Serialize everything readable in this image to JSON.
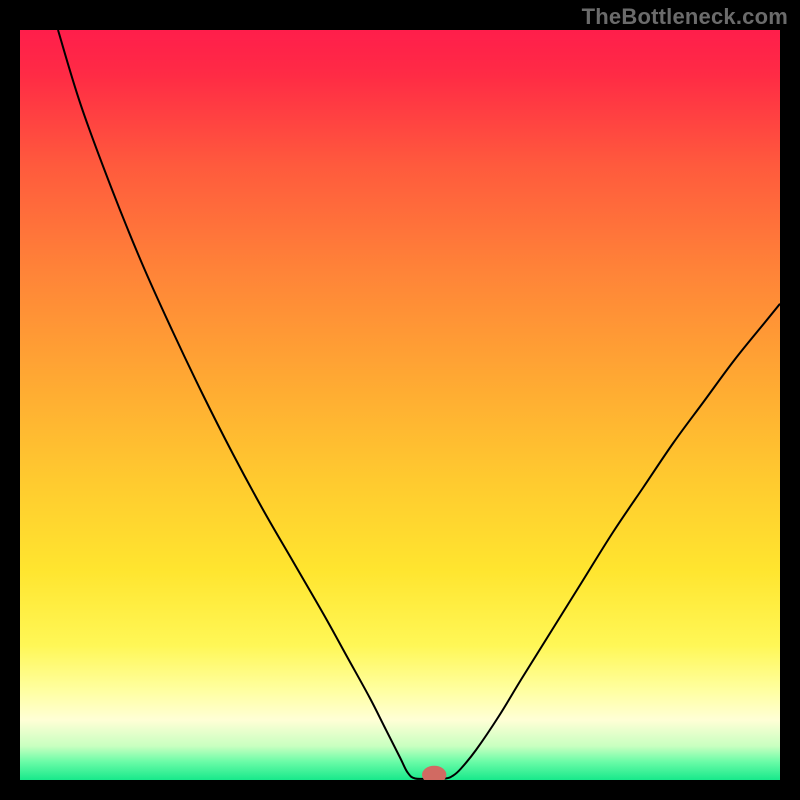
{
  "watermark": "TheBottleneck.com",
  "chart_data": {
    "type": "line",
    "title": "",
    "xlabel": "",
    "ylabel": "",
    "xlim": [
      0,
      100
    ],
    "ylim": [
      0,
      100
    ],
    "background_gradient": {
      "stops": [
        {
          "offset": 0.0,
          "color": "#ff1e4b"
        },
        {
          "offset": 0.06,
          "color": "#ff2b45"
        },
        {
          "offset": 0.18,
          "color": "#ff5a3d"
        },
        {
          "offset": 0.32,
          "color": "#ff8338"
        },
        {
          "offset": 0.46,
          "color": "#ffa733"
        },
        {
          "offset": 0.6,
          "color": "#ffca2f"
        },
        {
          "offset": 0.72,
          "color": "#ffe52f"
        },
        {
          "offset": 0.82,
          "color": "#fff756"
        },
        {
          "offset": 0.88,
          "color": "#ffffa0"
        },
        {
          "offset": 0.92,
          "color": "#ffffd6"
        },
        {
          "offset": 0.955,
          "color": "#c8ffc0"
        },
        {
          "offset": 0.975,
          "color": "#6dfca8"
        },
        {
          "offset": 1.0,
          "color": "#18e98b"
        }
      ]
    },
    "series": [
      {
        "name": "bottleneck-curve",
        "color": "#000000",
        "width": 2,
        "points": [
          [
            5.0,
            100.0
          ],
          [
            8.0,
            90.0
          ],
          [
            12.0,
            79.0
          ],
          [
            16.0,
            69.0
          ],
          [
            20.0,
            60.0
          ],
          [
            24.0,
            51.5
          ],
          [
            28.0,
            43.5
          ],
          [
            32.0,
            36.0
          ],
          [
            36.0,
            29.0
          ],
          [
            40.0,
            22.0
          ],
          [
            43.0,
            16.5
          ],
          [
            46.0,
            11.0
          ],
          [
            48.0,
            7.0
          ],
          [
            50.0,
            3.0
          ],
          [
            51.0,
            1.0
          ],
          [
            52.0,
            0.2
          ],
          [
            54.0,
            0.2
          ],
          [
            56.0,
            0.2
          ],
          [
            57.0,
            0.6
          ],
          [
            58.0,
            1.5
          ],
          [
            60.0,
            4.0
          ],
          [
            63.0,
            8.5
          ],
          [
            66.0,
            13.5
          ],
          [
            70.0,
            20.0
          ],
          [
            74.0,
            26.5
          ],
          [
            78.0,
            33.0
          ],
          [
            82.0,
            39.0
          ],
          [
            86.0,
            45.0
          ],
          [
            90.0,
            50.5
          ],
          [
            94.0,
            56.0
          ],
          [
            98.0,
            61.0
          ],
          [
            100.0,
            63.5
          ]
        ]
      }
    ],
    "marker": {
      "name": "optimal-point",
      "x": 54.5,
      "y": 0.7,
      "color": "#d16a62",
      "rx": 1.6,
      "ry": 1.2
    }
  }
}
